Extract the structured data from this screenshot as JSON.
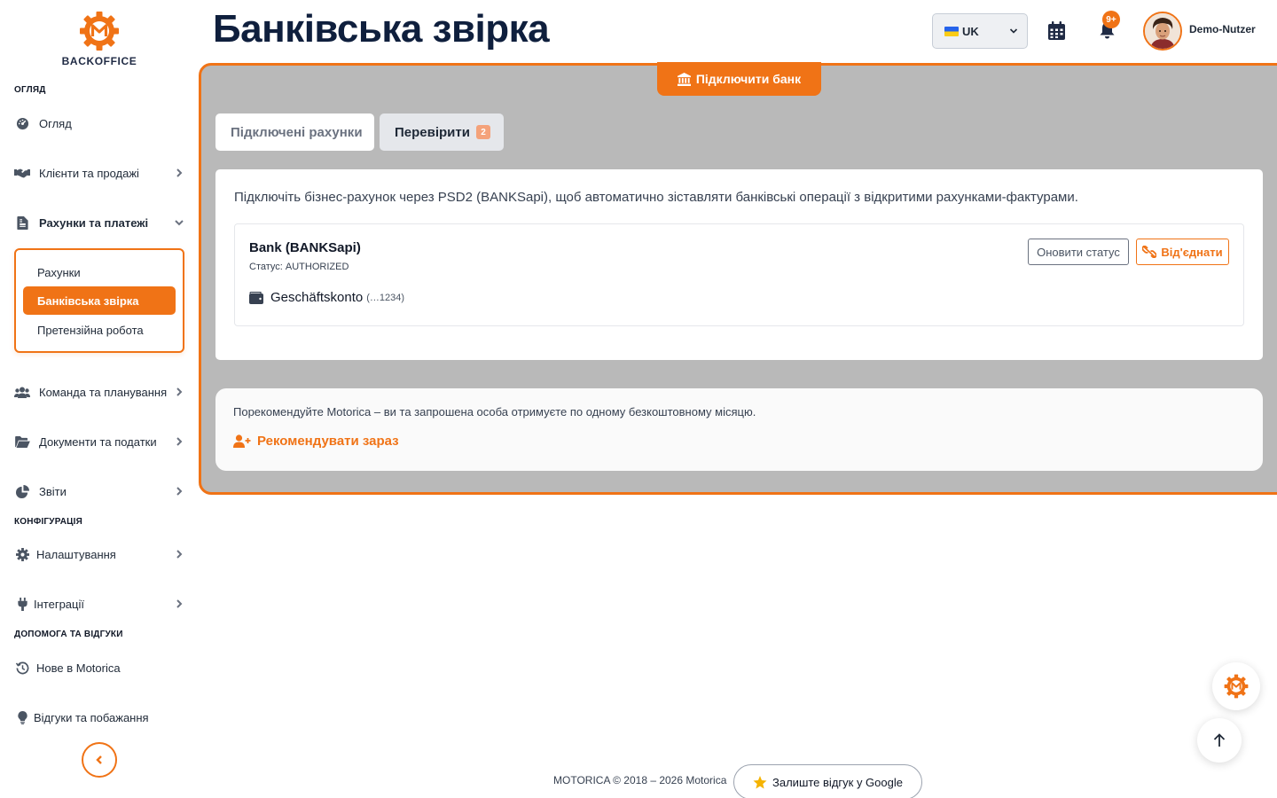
{
  "brand": {
    "name": "BACKOFFICE",
    "accent": "#f07316"
  },
  "sidebar": {
    "sections": [
      {
        "title": "ОГЛЯД"
      },
      {
        "title": "КОНФІГУРАЦІЯ"
      },
      {
        "title": "ДОПОМОГА ТА ВІДГУКИ"
      }
    ],
    "items": [
      {
        "label": "Огляд",
        "icon": "gauge-icon"
      },
      {
        "label": "Клієнти та продажі",
        "icon": "handshake-icon"
      },
      {
        "label": "Рахунки та платежі",
        "icon": "invoice-icon",
        "expanded": true
      },
      {
        "label": "Команда та планування",
        "icon": "users-icon"
      },
      {
        "label": "Документи та податки",
        "icon": "folder-icon"
      },
      {
        "label": "Звіти",
        "icon": "chart-pie-icon"
      },
      {
        "label": "Налаштування",
        "icon": "gear-icon"
      },
      {
        "label": "Інтеграції",
        "icon": "plug-icon"
      },
      {
        "label": "Нове в Motorica",
        "icon": "history-icon"
      },
      {
        "label": "Відгуки та побажання",
        "icon": "lightbulb-icon"
      }
    ],
    "submenu": [
      {
        "label": "Рахунки"
      },
      {
        "label": "Банківська звірка",
        "active": true
      },
      {
        "label": "Претензійна робота"
      }
    ]
  },
  "header": {
    "title": "Банківська звірка",
    "language": "UK",
    "notifications_badge": "9+",
    "user_name": "Demo-Nutzer"
  },
  "main": {
    "connect_button": "Підключити банк",
    "tabs": [
      {
        "label": "Підключені рахунки"
      },
      {
        "label": "Перевірити",
        "badge": "2"
      }
    ],
    "description": "Підключіть бізнес-рахунок через PSD2 (BANKSapi), щоб автоматично зіставляти банківські операції з відкритими рахунками-фактурами.",
    "bank": {
      "name": "Bank (BANKSapi)",
      "status": "Статус: AUTHORIZED",
      "account_name": "Geschäftskonto",
      "account_iban": "(…1234)",
      "refresh_label": "Оновити статус",
      "disconnect_label": "Від'єднати"
    },
    "referral": {
      "text": "Порекомендуйте Motorica – ви та запрошена особа отримуєте по одному безкоштовному місяцю.",
      "link": "Рекомендувати зараз"
    }
  },
  "footer": {
    "copyright": "MOTORICA © 2018 – 2026 Motorica",
    "review_button": "Залиште відгук у Google"
  }
}
